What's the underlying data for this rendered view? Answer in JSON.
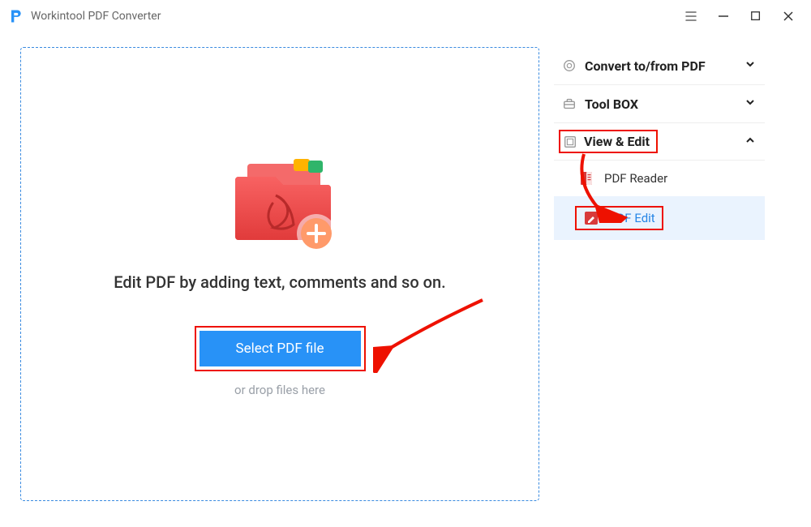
{
  "app": {
    "title": "Workintool PDF Converter"
  },
  "dropzone": {
    "title": "Edit PDF by adding text, comments and so on.",
    "button": "Select PDF file",
    "hint": "or drop files here"
  },
  "sidebar": {
    "convert": {
      "label": "Convert to/from PDF"
    },
    "toolbox": {
      "label": "Tool BOX"
    },
    "viewedit": {
      "label": "View & Edit"
    },
    "items": [
      {
        "label": "PDF Reader"
      },
      {
        "label": "PDF Edit"
      }
    ]
  }
}
